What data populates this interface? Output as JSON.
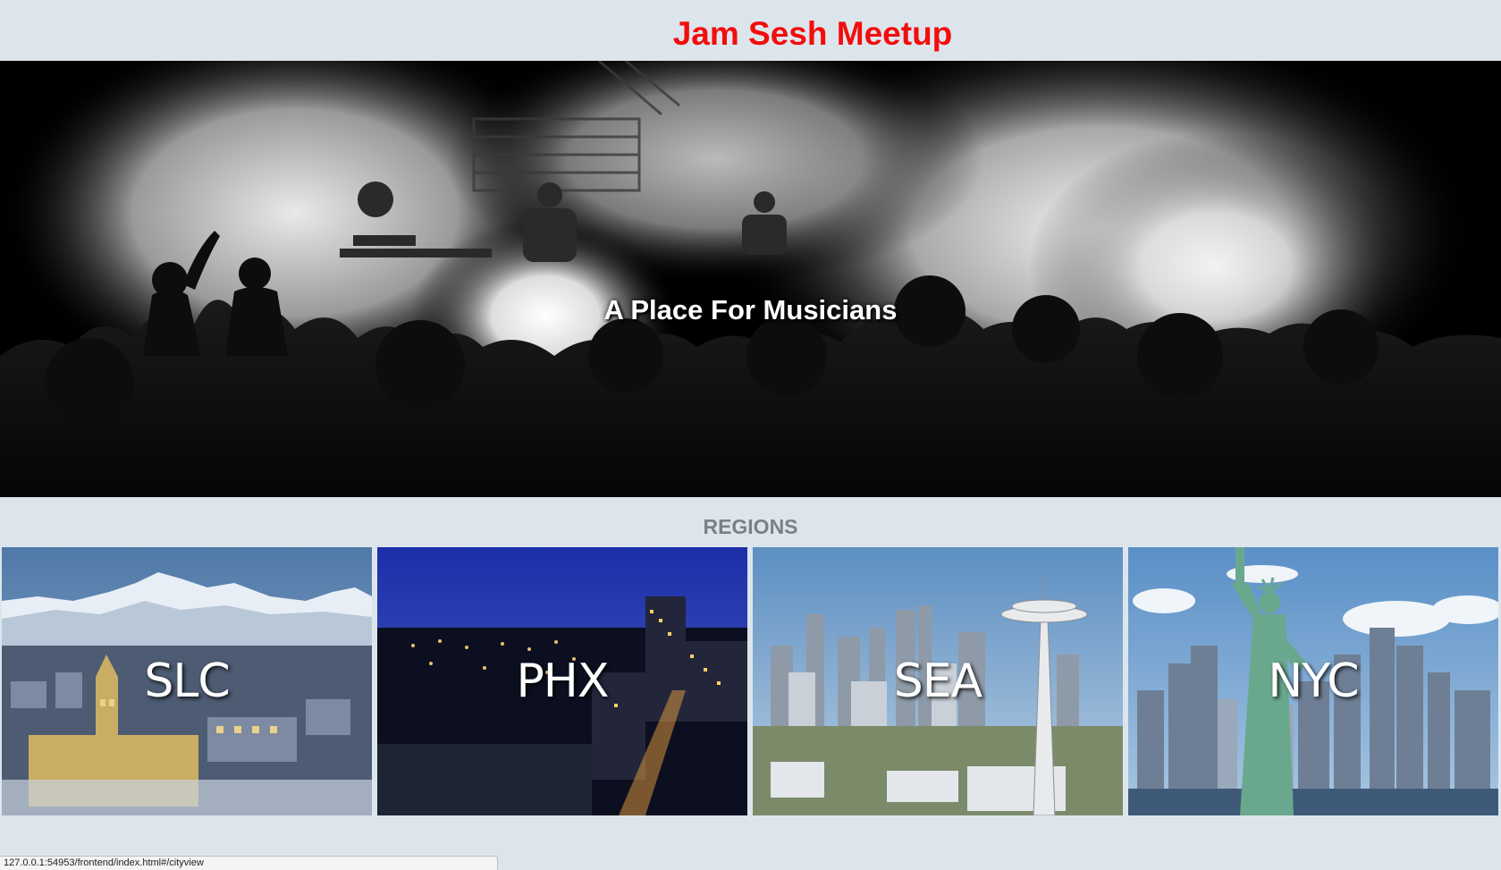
{
  "header": {
    "title": "Jam Sesh Meetup",
    "title_color": "#f20d0d"
  },
  "hero": {
    "tagline": "A Place For Musicians",
    "image": "concert-crowd-photo"
  },
  "regions": {
    "heading": "REGIONS",
    "items": [
      {
        "label": "SLC",
        "image": "salt-lake-city-photo"
      },
      {
        "label": "PHX",
        "image": "phoenix-night-photo"
      },
      {
        "label": "SEA",
        "image": "seattle-space-needle-photo"
      },
      {
        "label": "NYC",
        "image": "statue-of-liberty-photo"
      }
    ]
  },
  "status_bar": {
    "url": "127.0.0.1:54953/frontend/index.html#/cityview"
  }
}
